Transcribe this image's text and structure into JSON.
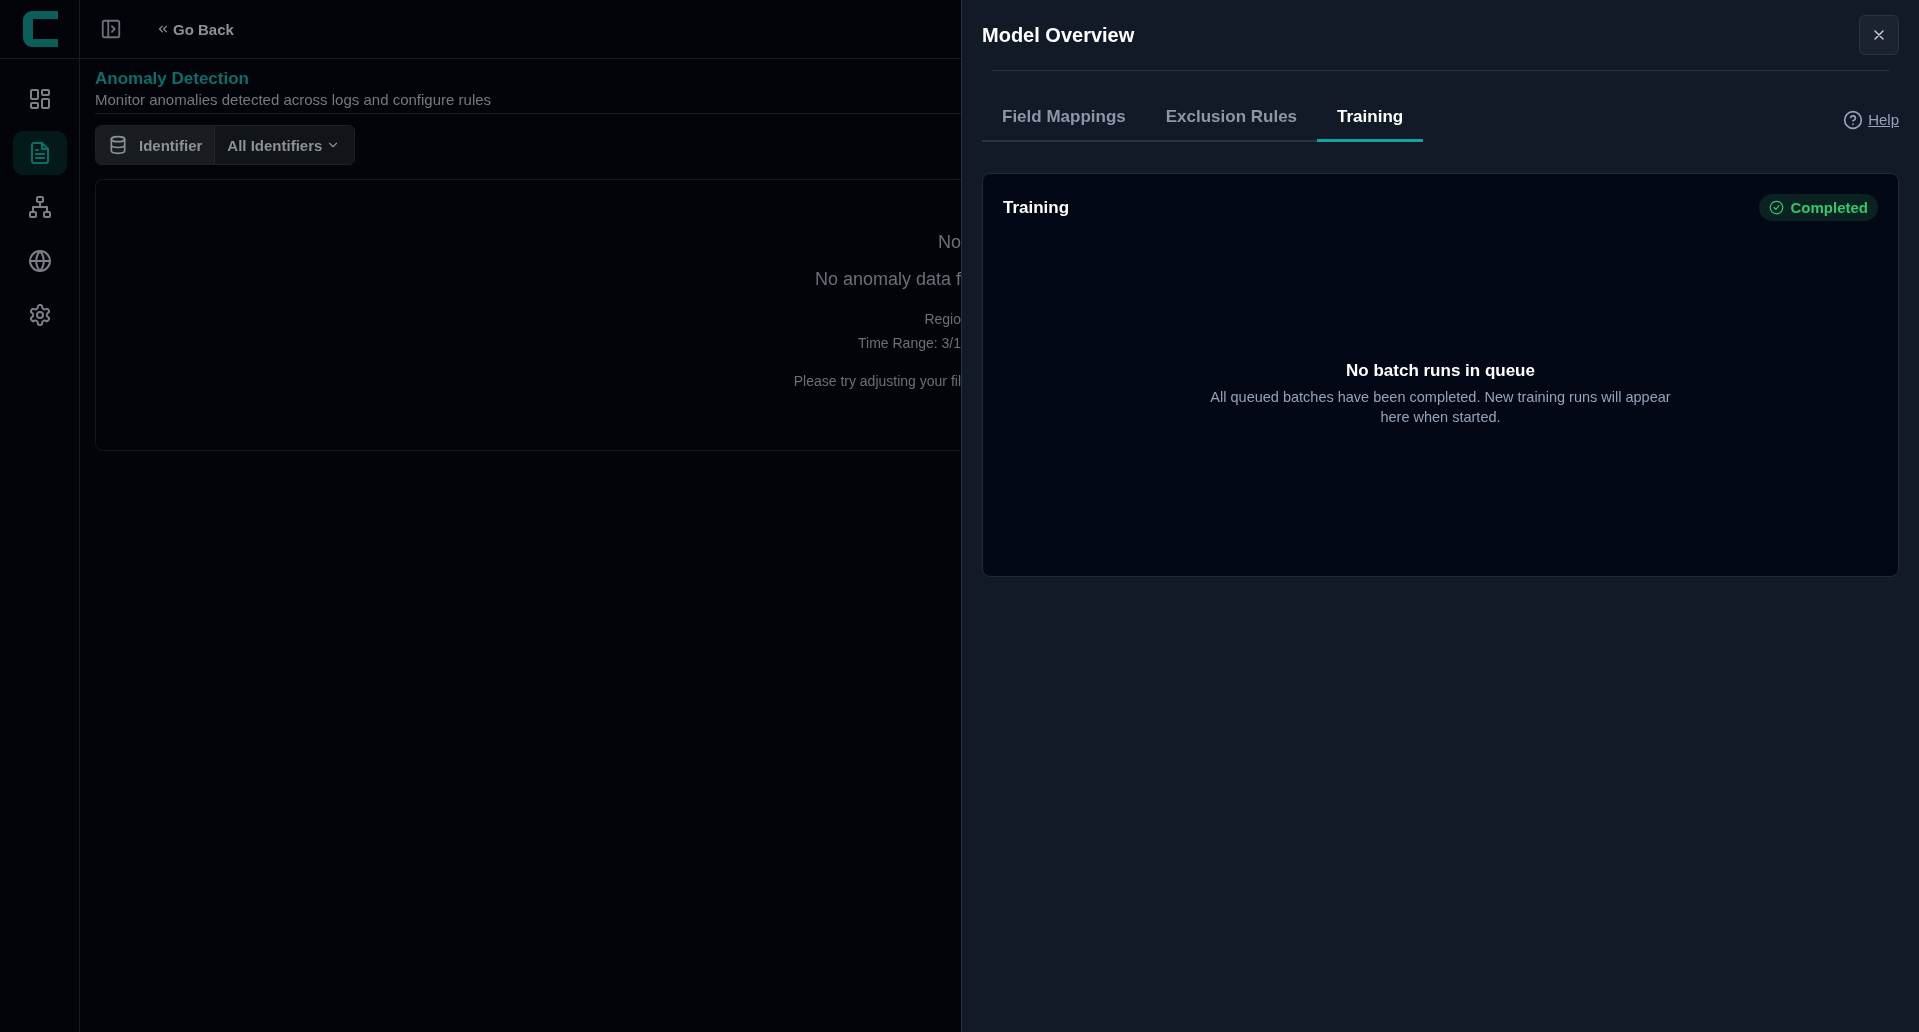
{
  "sidebar": {
    "items": [
      {
        "kind": "grid",
        "selected": false
      },
      {
        "kind": "document",
        "selected": true
      },
      {
        "kind": "hierarchy",
        "selected": false
      },
      {
        "kind": "globe",
        "selected": false
      },
      {
        "kind": "settings",
        "selected": false
      }
    ]
  },
  "header": {
    "back": "Go Back"
  },
  "page": {
    "title": "Anomaly Detection",
    "subtitle": "Monitor anomalies detected across logs and configure rules",
    "filter": {
      "label": "Identifier",
      "value": "All Identifiers"
    },
    "empty_state": {
      "lines": [
        "No",
        "No anomaly data f",
        "Regio",
        "Time Range: 3/1",
        "Please try adjusting your fil"
      ]
    }
  },
  "panel": {
    "title": "Model Overview",
    "tabs": [
      {
        "label": "Field Mappings",
        "selected": false
      },
      {
        "label": "Exclusion Rules",
        "selected": false
      },
      {
        "label": "Training",
        "selected": true
      }
    ],
    "help": "Help",
    "card": {
      "title": "Training",
      "status": "Completed",
      "empty_title": "No batch runs in queue",
      "empty_text": "All queued batches have been completed. New training runs will appear here when started."
    }
  }
}
